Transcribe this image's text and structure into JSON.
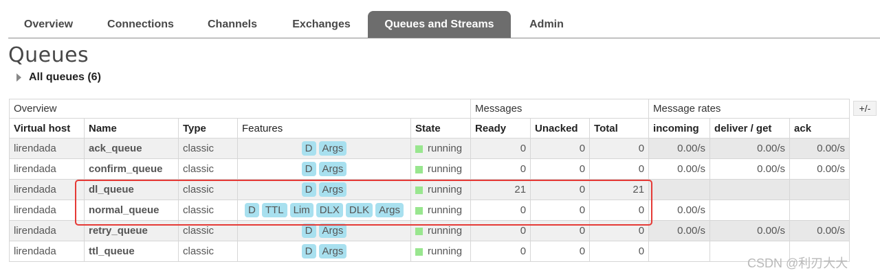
{
  "nav": {
    "tabs": [
      "Overview",
      "Connections",
      "Channels",
      "Exchanges",
      "Queues and Streams",
      "Admin"
    ],
    "active": "Queues and Streams"
  },
  "page": {
    "title": "Queues",
    "section_label": "All queues (6)",
    "toggle_columns": "+/-",
    "watermark": "CSDN @利刃大大"
  },
  "table": {
    "groups": [
      "Overview",
      "Messages",
      "Message rates"
    ],
    "columns": [
      "Virtual host",
      "Name",
      "Type",
      "Features",
      "State",
      "Ready",
      "Unacked",
      "Total",
      "incoming",
      "deliver / get",
      "ack"
    ],
    "rows": [
      {
        "vhost": "lirendada",
        "name": "ack_queue",
        "type": "classic",
        "features": [
          "D",
          "Args"
        ],
        "state": "running",
        "ready": "0",
        "unacked": "0",
        "total": "0",
        "incoming": "0.00/s",
        "deliver": "0.00/s",
        "ack": "0.00/s"
      },
      {
        "vhost": "lirendada",
        "name": "confirm_queue",
        "type": "classic",
        "features": [
          "D",
          "Args"
        ],
        "state": "running",
        "ready": "0",
        "unacked": "0",
        "total": "0",
        "incoming": "0.00/s",
        "deliver": "0.00/s",
        "ack": "0.00/s"
      },
      {
        "vhost": "lirendada",
        "name": "dl_queue",
        "type": "classic",
        "features": [
          "D",
          "Args"
        ],
        "state": "running",
        "ready": "21",
        "unacked": "0",
        "total": "21",
        "incoming": "",
        "deliver": "",
        "ack": ""
      },
      {
        "vhost": "lirendada",
        "name": "normal_queue",
        "type": "classic",
        "features": [
          "D",
          "TTL",
          "Lim",
          "DLX",
          "DLK",
          "Args"
        ],
        "state": "running",
        "ready": "0",
        "unacked": "0",
        "total": "0",
        "incoming": "0.00/s",
        "deliver": "",
        "ack": ""
      },
      {
        "vhost": "lirendada",
        "name": "retry_queue",
        "type": "classic",
        "features": [
          "D",
          "Args"
        ],
        "state": "running",
        "ready": "0",
        "unacked": "0",
        "total": "0",
        "incoming": "0.00/s",
        "deliver": "0.00/s",
        "ack": "0.00/s"
      },
      {
        "vhost": "lirendada",
        "name": "ttl_queue",
        "type": "classic",
        "features": [
          "D",
          "Args"
        ],
        "state": "running",
        "ready": "0",
        "unacked": "0",
        "total": "0",
        "incoming": "",
        "deliver": "",
        "ack": ""
      }
    ]
  },
  "colors": {
    "active_tab": "#6d6d6d",
    "feature_badge": "#a8e0ef",
    "running": "#99e68f",
    "highlight": "#e53935"
  }
}
